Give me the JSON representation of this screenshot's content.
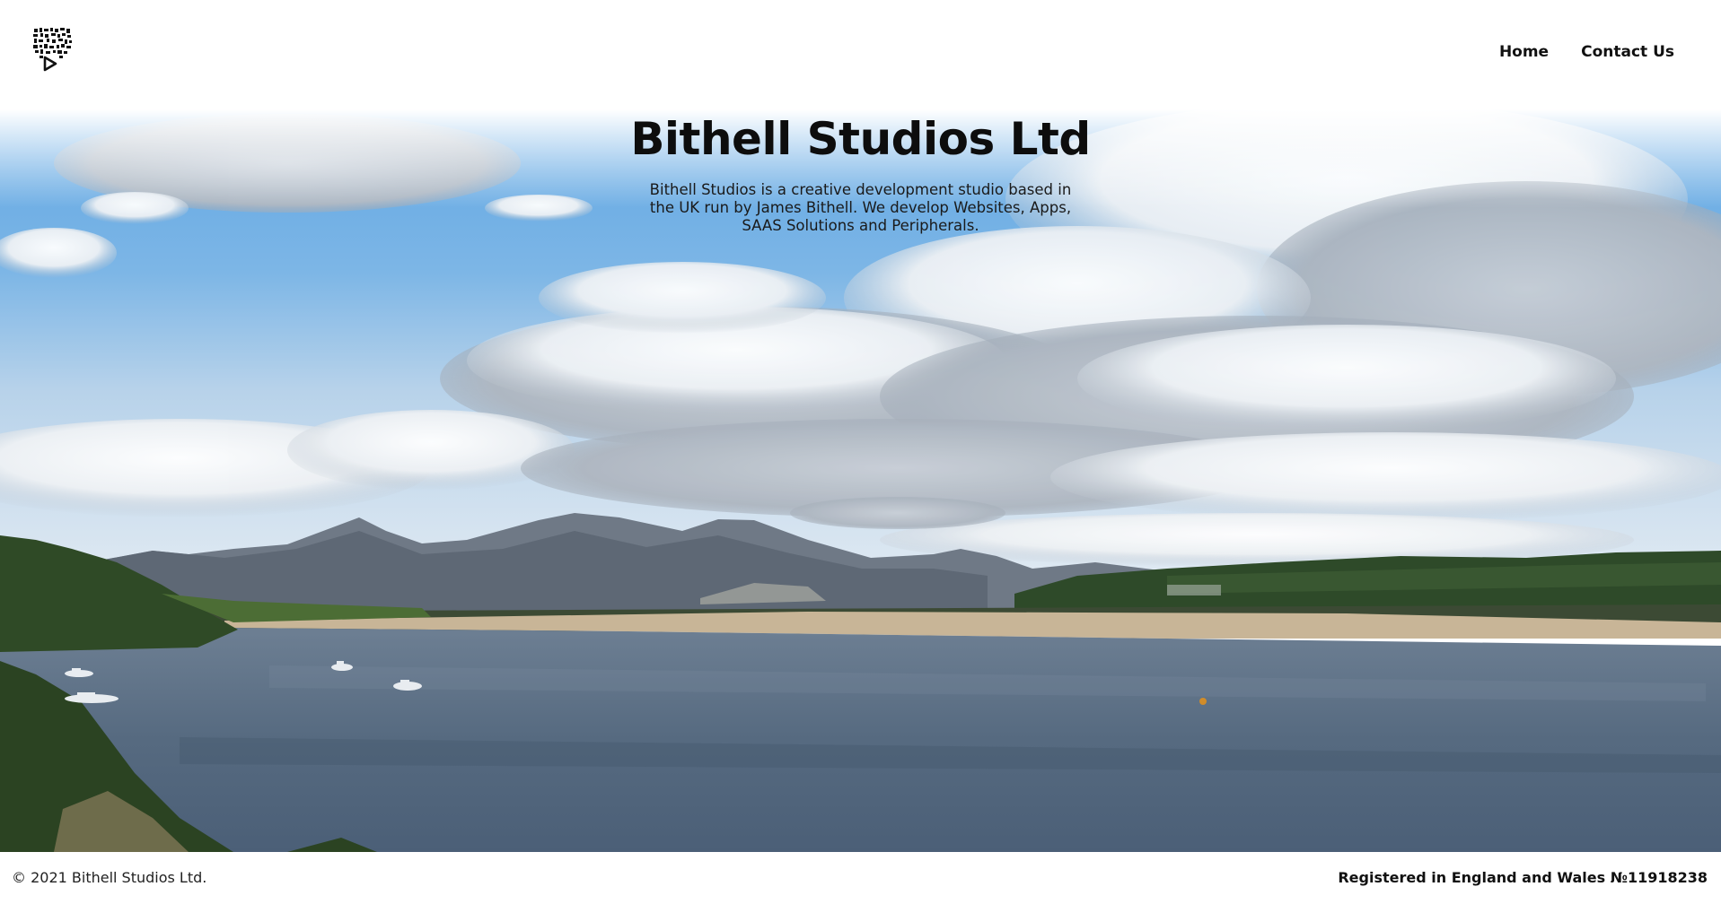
{
  "header": {
    "logo_icon": "studio-qr-play-logo",
    "nav": {
      "home": "Home",
      "contact": "Contact Us"
    }
  },
  "hero": {
    "title": "Bithell Studios Ltd",
    "description": "Bithell Studios is a creative development studio based in the UK run by James Bithell. We develop Websites, Apps, SAAS Solutions and Peripherals.",
    "background": "estuary-landscape-photo"
  },
  "footer": {
    "copyright": "© 2021 Bithell Studios Ltd.",
    "registered": "Registered in England and Wales №11918238"
  },
  "colors": {
    "sky_top": "#6aaee6",
    "sky_bottom": "#cfe3f3",
    "water": "#5a6e84",
    "hills": "#2f4a28",
    "mountains": "#6d7682",
    "sand": "#c9b79a"
  }
}
